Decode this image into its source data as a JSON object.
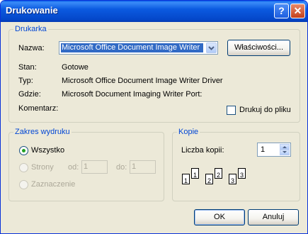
{
  "window": {
    "title": "Drukowanie",
    "help_icon_text": "?",
    "close_icon_text": "✕"
  },
  "printer": {
    "group_label": "Drukarka",
    "name_label": "Nazwa:",
    "name_value": "Microsoft Office Document Image Writer",
    "properties_button": "Właściwości...",
    "status_label": "Stan:",
    "status_value": "Gotowe",
    "type_label": "Typ:",
    "type_value": "Microsoft Office Document Image Writer Driver",
    "where_label": "Gdzie:",
    "where_value": "Microsoft Document Imaging Writer Port:",
    "comment_label": "Komentarz:",
    "print_to_file_label": "Drukuj do pliku",
    "print_to_file_checked": false
  },
  "range": {
    "group_label": "Zakres wydruku",
    "all_label": "Wszystko",
    "pages_label": "Strony",
    "from_label": "od:",
    "from_value": "1",
    "to_label": "do:",
    "to_value": "1",
    "selection_label": "Zaznaczenie",
    "selected": "all"
  },
  "copies": {
    "group_label": "Kopie",
    "count_label": "Liczba kopii:",
    "count_value": "1",
    "collate_pages": [
      "1",
      "1",
      "2",
      "2",
      "3",
      "3"
    ]
  },
  "buttons": {
    "ok": "OK",
    "cancel": "Anuluj"
  }
}
